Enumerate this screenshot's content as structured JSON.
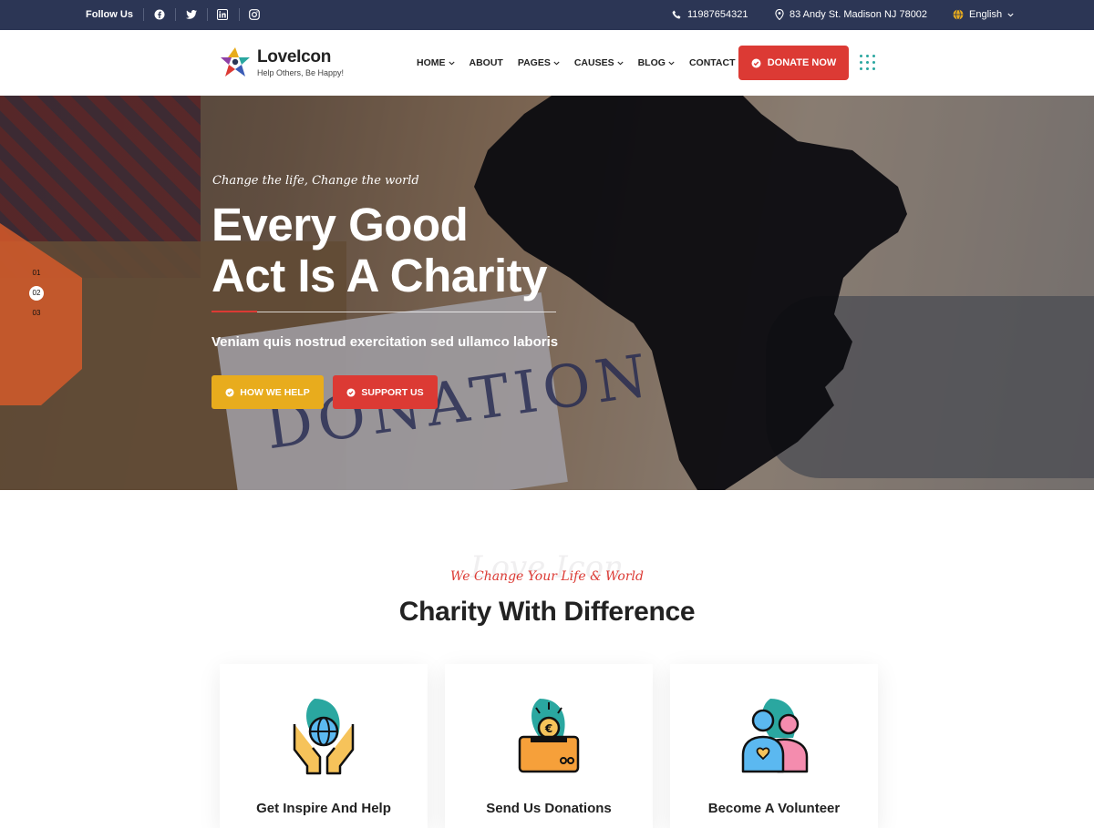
{
  "topbar": {
    "follow_label": "Follow Us",
    "social": [
      "facebook-icon",
      "twitter-icon",
      "linkedin-icon",
      "instagram-icon"
    ],
    "phone": "11987654321",
    "address": "83 Andy St. Madison NJ 78002",
    "language": "English"
  },
  "header": {
    "logo_name": "LoveIcon",
    "logo_tagline": "Help Others, Be Happy!",
    "nav": [
      {
        "label": "HOME",
        "dropdown": true
      },
      {
        "label": "ABOUT",
        "dropdown": false
      },
      {
        "label": "PAGES",
        "dropdown": true
      },
      {
        "label": "CAUSES",
        "dropdown": true
      },
      {
        "label": "BLOG",
        "dropdown": true
      },
      {
        "label": "CONTACT",
        "dropdown": false
      }
    ],
    "donate_label": "DONATE NOW"
  },
  "hero": {
    "eyebrow": "Change the life, Change the world",
    "title_line1": "Every Good",
    "title_line2": "Act Is A Charity",
    "subtitle": "Veniam quis nostrud exercitation sed ullamco laboris",
    "paper_text": "DONATION",
    "slides": [
      "01",
      "02",
      "03"
    ],
    "active_slide": "02",
    "btn_help": "HOW WE HELP",
    "btn_support": "SUPPORT US"
  },
  "section": {
    "watermark": "Love Icon",
    "eyebrow": "We Change Your Life & World",
    "title": "Charity With Difference",
    "cards": [
      {
        "title": "Get Inspire And Help",
        "icon": "globe-hands-icon"
      },
      {
        "title": "Send Us Donations",
        "icon": "wallet-coin-icon"
      },
      {
        "title": "Become A Volunteer",
        "icon": "volunteers-icon"
      }
    ]
  },
  "colors": {
    "topbar": "#2c3655",
    "accent_red": "#dc3a34",
    "accent_yellow": "#e8ac1d",
    "accent_teal": "#2aa7a0"
  }
}
